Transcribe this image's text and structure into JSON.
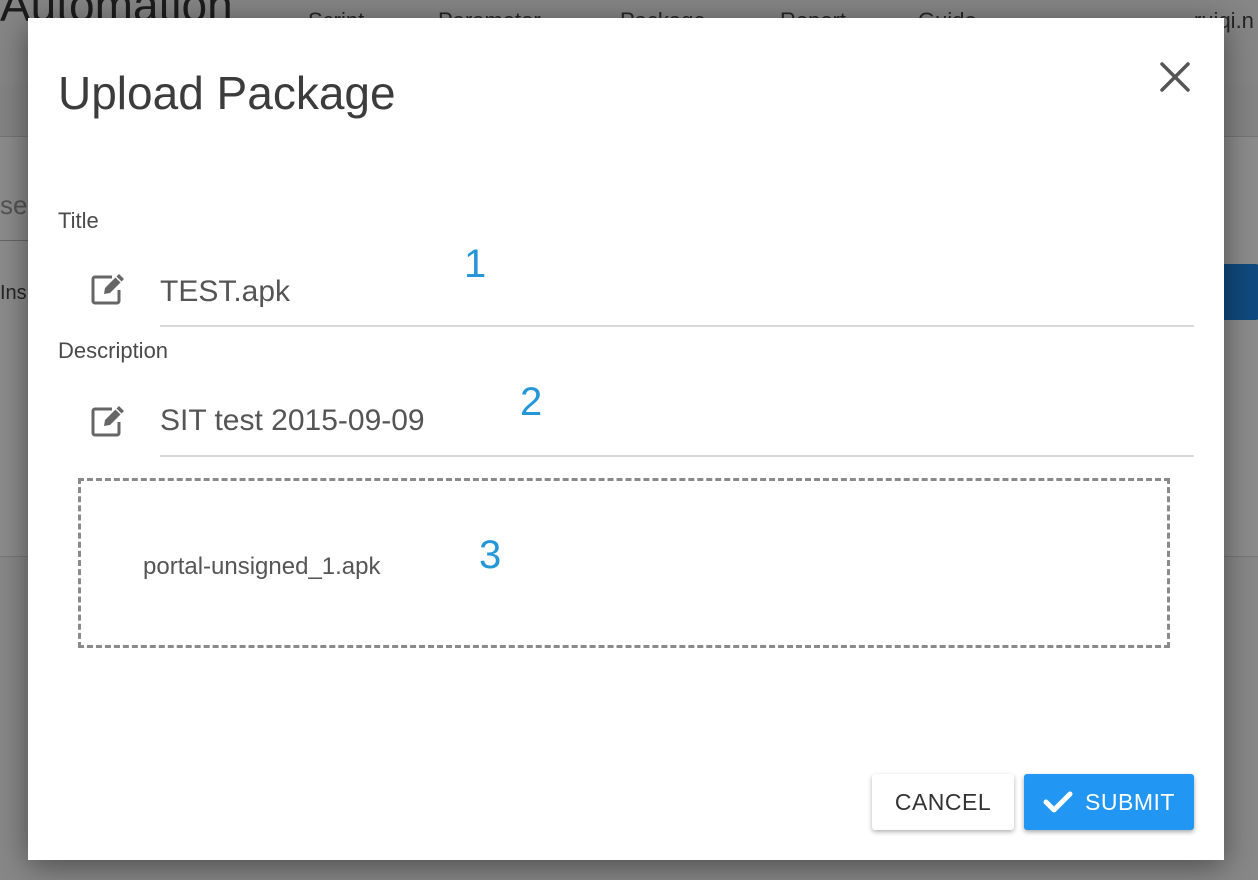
{
  "background": {
    "app_title": "Automation",
    "nav_items": [
      "Script",
      "Parameter",
      "Package",
      "Report",
      "Guide"
    ],
    "user": "ruiqi.n",
    "search_partial": "se",
    "row_partial": "Ins"
  },
  "dialog": {
    "title": "Upload Package",
    "close_icon": "close-icon",
    "title_field": {
      "label": "Title",
      "value": "TEST.apk",
      "icon": "edit-icon"
    },
    "description_field": {
      "label": "Description",
      "value": "SIT test 2015-09-09",
      "icon": "edit-icon"
    },
    "dropzone": {
      "file_name": "portal-unsigned_1.apk"
    },
    "annotations": [
      "1",
      "2",
      "3"
    ],
    "buttons": {
      "cancel": "CANCEL",
      "submit": "SUBMIT",
      "submit_icon": "check-icon"
    }
  },
  "colors": {
    "accent": "#2196f3",
    "annotation": "#2596d8",
    "overlay": "#000000"
  }
}
